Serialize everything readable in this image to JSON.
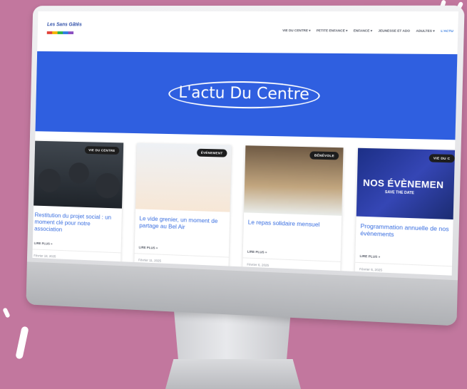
{
  "nav": {
    "menu": [
      {
        "label": "VIE DU CENTRE ▾"
      },
      {
        "label": "PETITE ENFANCE ▾"
      },
      {
        "label": "ENFANCE ▾"
      },
      {
        "label": "JEUNESSE ET ADO"
      },
      {
        "label": "ADULTES ▾"
      },
      {
        "label": "L'ACTU"
      }
    ]
  },
  "hero": {
    "title": "L'actu Du Centre"
  },
  "cards": [
    {
      "badge": "VIE DU CENTRE",
      "title": "Restitution du projet social : un moment clé pour notre association",
      "more": "LIRE PLUS »",
      "date": "Février 18, 2025"
    },
    {
      "badge": "ÉVÉNEMENT",
      "title": "Le vide grenier, un moment de partage au Bel Air",
      "more": "LIRE PLUS »",
      "date": "Février 11, 2025"
    },
    {
      "badge": "BÉNÉVOLE",
      "title": "Le repas solidaire mensuel",
      "more": "LIRE PLUS »",
      "date": "Février 6, 2025"
    },
    {
      "badge": "VIE DU C",
      "title": "Programmation annuelle de nos évènements",
      "more": "LIRE PLUS »",
      "date": "Février 6, 2025",
      "image_text": "NOS ÉVÈNEMEN",
      "image_subtext": "SAVE THE DATE"
    }
  ],
  "colors": {
    "background": "#c2779e",
    "hero": "#2f5fe0",
    "link": "#3a6fe0"
  }
}
